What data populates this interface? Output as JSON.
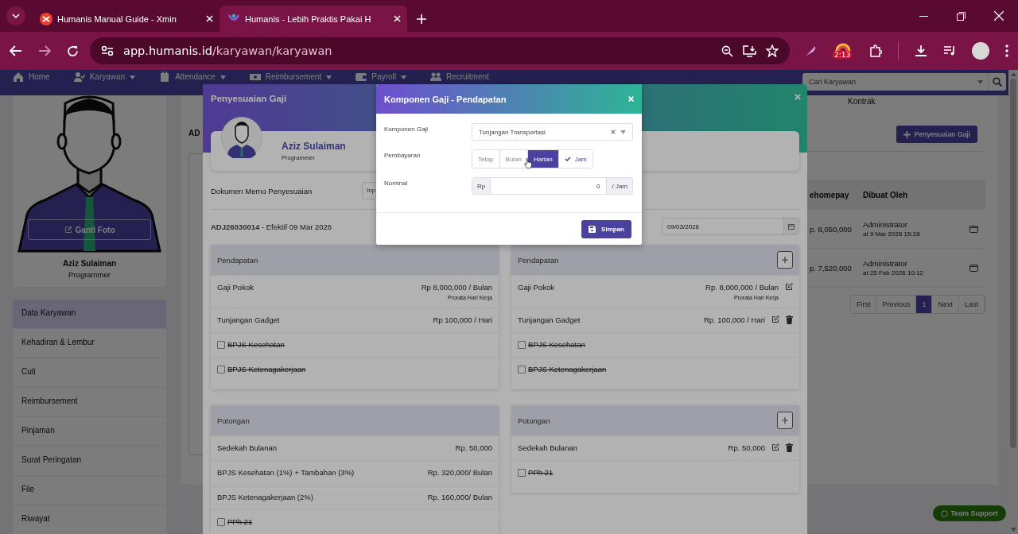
{
  "browser": {
    "tabs": [
      {
        "title": "Humanis Manual Guide - Xmin",
        "selected": false
      },
      {
        "title": "Humanis - Lebih Praktis Pakai H",
        "selected": true
      }
    ],
    "url_host": "app.humanis.id",
    "url_path": "/karyawan/karyawan",
    "extension_badge": "2:13"
  },
  "nav": {
    "items": [
      {
        "label": "Home",
        "dropdown": false
      },
      {
        "label": "Karyawan",
        "dropdown": true
      },
      {
        "label": "Attendance",
        "dropdown": true
      },
      {
        "label": "Reimbursement",
        "dropdown": true
      },
      {
        "label": "Payroll",
        "dropdown": true
      },
      {
        "label": "Recruitment",
        "dropdown": false
      }
    ],
    "search_placeholder": "Cari Karyawan"
  },
  "profile": {
    "change_photo": "Ganti Foto",
    "name": "Aziz Sulaiman",
    "role": "Programmer"
  },
  "menu": [
    {
      "label": "Data Karyawan",
      "selected": true
    },
    {
      "label": "Kehadiran & Lembur",
      "selected": false
    },
    {
      "label": "Cuti",
      "selected": false
    },
    {
      "label": "Reimbursement",
      "selected": false
    },
    {
      "label": "Pinjaman",
      "selected": false
    },
    {
      "label": "Surat Peringatan",
      "selected": false
    },
    {
      "label": "File",
      "selected": false
    },
    {
      "label": "Riwayat",
      "selected": false
    }
  ],
  "main": {
    "tab_label": "Kontrak",
    "heading": "AD",
    "add_button": "Penyesuaian Gaji",
    "table": {
      "columns": [
        "ehomepay",
        "Dibuat Oleh"
      ],
      "rows": [
        {
          "take_homepay": "p. 8,050,000",
          "created_by": "Administrator",
          "created_at": "at 9 Mar 2026 15:28"
        },
        {
          "take_homepay": "p. 7,520,000",
          "created_by": "Administrator",
          "created_at": "at 25 Feb 2026 10:12"
        }
      ]
    },
    "pagination": [
      {
        "label": "First",
        "selected": false
      },
      {
        "label": "Previous",
        "selected": false
      },
      {
        "label": "1",
        "selected": true
      },
      {
        "label": "Next",
        "selected": false
      },
      {
        "label": "Last",
        "selected": false
      }
    ]
  },
  "support_button": "Team Support",
  "adjustment": {
    "title": "Penyesuaian Gaji",
    "employee": {
      "name": "Aziz Sulaiman",
      "role": "Programmer"
    },
    "memo_label": "Dokumen Memo Penyesuaian",
    "memo_placeholder": "Inp",
    "summary": "**ADJ26030014** - Efektif 09 Mar 2026",
    "date": "09/03/2026",
    "panels": [
      {
        "sections": [
          {
            "title": "Pendapatan",
            "addable": false,
            "items": [
              {
                "kind": "amount",
                "name": "Gaji Pokok",
                "amount": "Rp 8,000,000 / Bulan",
                "note": "Prorata Hari Kerja",
                "editable": false,
                "deletable": false
              },
              {
                "kind": "amount",
                "name": "Tunjangan Gadget",
                "amount": "Rp 100,000 / Hari",
                "editable": false,
                "deletable": false
              },
              {
                "kind": "toggle",
                "name": "BPJS Kesehatan",
                "checked": false
              },
              {
                "kind": "toggle",
                "name": "BPJS Ketenagakerjaan",
                "checked": false
              }
            ]
          },
          {
            "title": "Potongan",
            "addable": false,
            "items": [
              {
                "kind": "amount",
                "name": "Sedekah Bulanan",
                "amount": "Rp. 50,000",
                "editable": false,
                "deletable": false
              },
              {
                "kind": "amount",
                "name": "BPJS Kesehatan (1%) + Tambahan (3%)",
                "amount": "Rp. 320,000/ Bulan",
                "editable": false,
                "deletable": false
              },
              {
                "kind": "amount",
                "name": "BPJS Ketenagakerjaan (2%)",
                "amount": "Rp. 160,000/ Bulan",
                "editable": false,
                "deletable": false
              },
              {
                "kind": "toggle",
                "name": "PPh 21",
                "checked": false
              }
            ]
          }
        ]
      },
      {
        "sections": [
          {
            "title": "Pendapatan",
            "addable": true,
            "items": [
              {
                "kind": "amount",
                "name": "Gaji Pokok",
                "amount": "Rp. 8,000,000 / Bulan",
                "note": "Prorata Hari Kerja",
                "editable": true,
                "deletable": false
              },
              {
                "kind": "amount",
                "name": "Tunjangan Gadget",
                "amount": "Rp. 100,000 / Hari",
                "editable": true,
                "deletable": true
              },
              {
                "kind": "toggle",
                "name": "BPJS Kesehatan",
                "checked": false
              },
              {
                "kind": "toggle",
                "name": "BPJS Ketenagakerjaan",
                "checked": false
              }
            ]
          },
          {
            "title": "Potongan",
            "addable": true,
            "items": [
              {
                "kind": "amount",
                "name": "Sedekah Bulanan",
                "amount": "Rp. 50,000",
                "editable": true,
                "deletable": true
              },
              {
                "kind": "toggle",
                "name": "PPh 21",
                "checked": false
              }
            ]
          }
        ]
      }
    ]
  },
  "component_modal": {
    "title": "Komponen Gaji - Pendapatan",
    "component_label": "Komponen Gaji",
    "component_value": "Tunjangan Transportasi",
    "payment_label": "Pembayaran",
    "payment_options": [
      {
        "label": "Tetap",
        "selected": false,
        "hovered": false
      },
      {
        "label": "Bulan",
        "selected": false,
        "hovered": false
      },
      {
        "label": "Harian",
        "selected": false,
        "hovered": true
      },
      {
        "label": "Jam",
        "selected": true,
        "hovered": false
      }
    ],
    "nominal_label": "Nominal",
    "currency": "Rp",
    "nominal_value": "0",
    "unit": "/ Jam",
    "save_button": "Simpan"
  }
}
